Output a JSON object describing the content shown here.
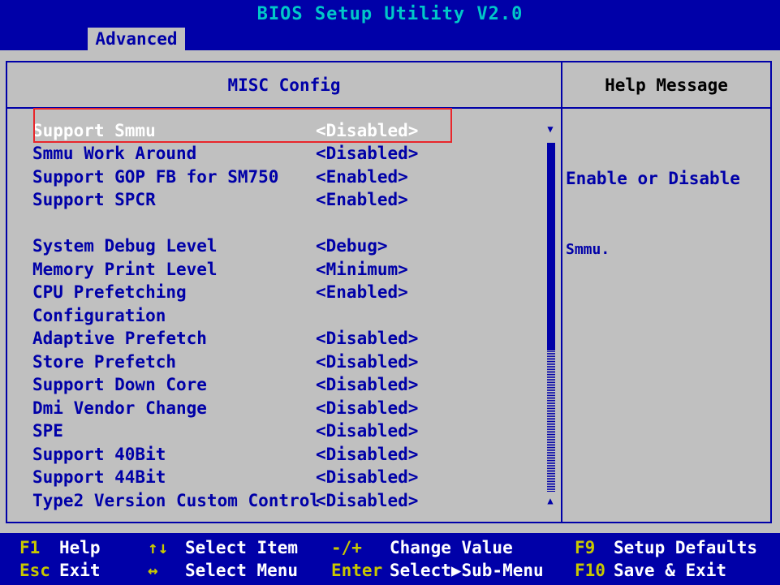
{
  "window": {
    "title": "BIOS Setup Utility V2.0",
    "active_tab": "Advanced"
  },
  "panel": {
    "title": "MISC Config",
    "help_title": "Help Message",
    "help_text_line1": "Enable or Disable",
    "help_text_line2": "Smmu."
  },
  "items": [
    {
      "label": "Support Smmu",
      "value": "<Disabled>"
    },
    {
      "label": "Smmu Work Around",
      "value": "<Disabled>"
    },
    {
      "label": "Support GOP FB for SM750",
      "value": "<Enabled>"
    },
    {
      "label": "Support SPCR",
      "value": "<Enabled>"
    },
    {
      "label": "System Debug Level",
      "value": "<Debug>"
    },
    {
      "label": "Memory Print Level",
      "value": "<Minimum>"
    },
    {
      "label": "CPU Prefetching",
      "value": "<Enabled>"
    },
    {
      "label": "Configuration",
      "value": ""
    },
    {
      "label": "Adaptive Prefetch",
      "value": "<Disabled>"
    },
    {
      "label": "Store Prefetch",
      "value": "<Disabled>"
    },
    {
      "label": "Support Down Core",
      "value": "<Disabled>"
    },
    {
      "label": "Dmi Vendor Change",
      "value": "<Disabled>"
    },
    {
      "label": "SPE",
      "value": "<Disabled>"
    },
    {
      "label": "Support 40Bit",
      "value": "<Disabled>"
    },
    {
      "label": "Support 44Bit",
      "value": "<Disabled>"
    },
    {
      "label": "Type2 Version Custom Control",
      "value": "<Disabled>"
    }
  ],
  "scroll": {
    "up_arrow": "▼",
    "down_arrow": "▲"
  },
  "footer": {
    "f1_key": "F1",
    "f1_desc": "Help",
    "esc_key": "Esc",
    "esc_desc": "Exit",
    "updown_key": "↑↓",
    "updown_desc": "Select Item",
    "leftright_key": "↔",
    "leftright_desc": "Select Menu",
    "minusplus_key": "-/+",
    "minusplus_desc": "Change Value",
    "enter_key": "Enter",
    "enter_desc": "Select▶Sub-Menu",
    "f9_key": "F9",
    "f9_desc": "Setup Defaults",
    "f10_key": "F10",
    "f10_desc": "Save & Exit"
  },
  "colors": {
    "background": "#0000a8",
    "panel": "#c0c0c0",
    "selected_text": "#ffffff",
    "title_text": "#00c8c8",
    "footer_key": "#c8c800",
    "highlight_border": "#e8262b"
  }
}
